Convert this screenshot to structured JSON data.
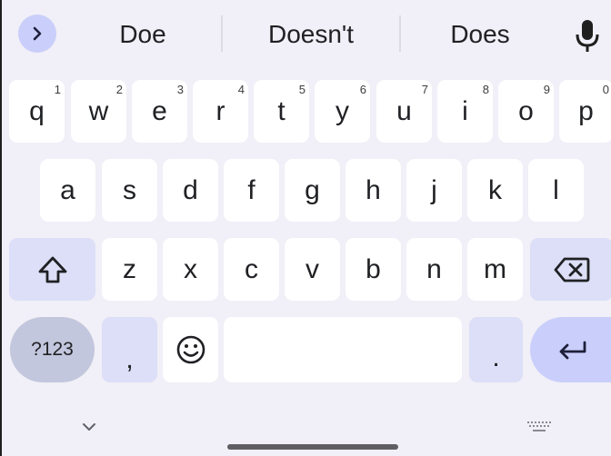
{
  "suggestions": [
    "Doe",
    "Doesn't",
    "Does"
  ],
  "icons": {
    "expand": "chevron-right-icon",
    "mic": "microphone-icon",
    "shift": "shift-arrow-icon",
    "backspace": "backspace-icon",
    "emoji": "emoji-icon",
    "enter": "enter-icon",
    "hide": "chevron-down-icon",
    "switch": "keyboard-icon"
  },
  "keyboard": {
    "row1": [
      {
        "key": "q",
        "hint": "1"
      },
      {
        "key": "w",
        "hint": "2"
      },
      {
        "key": "e",
        "hint": "3"
      },
      {
        "key": "r",
        "hint": "4"
      },
      {
        "key": "t",
        "hint": "5"
      },
      {
        "key": "y",
        "hint": "6"
      },
      {
        "key": "u",
        "hint": "7"
      },
      {
        "key": "i",
        "hint": "8"
      },
      {
        "key": "o",
        "hint": "9"
      },
      {
        "key": "p",
        "hint": "0"
      }
    ],
    "row2": [
      "a",
      "s",
      "d",
      "f",
      "g",
      "h",
      "j",
      "k",
      "l"
    ],
    "row3": [
      "z",
      "x",
      "c",
      "v",
      "b",
      "n",
      "m"
    ],
    "symbols_label": "?123",
    "comma_label": ",",
    "period_label": "."
  },
  "colors": {
    "background": "#f1eff7",
    "key": "#ffffff",
    "special_key": "#dcdff7",
    "accent": "#c9cffa",
    "symbols_key": "#c3c7dd"
  }
}
